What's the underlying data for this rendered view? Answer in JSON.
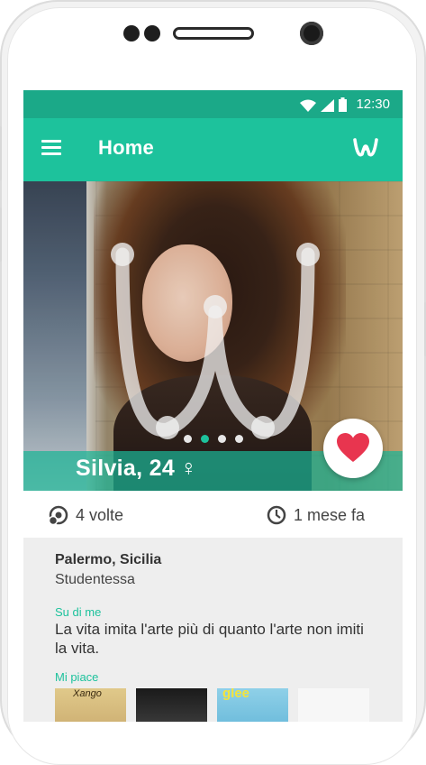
{
  "status_bar": {
    "time": "12:30",
    "icons": [
      "wifi-icon",
      "signal-icon",
      "battery-icon"
    ]
  },
  "app_bar": {
    "title": "Home",
    "menu_icon": "menu-icon",
    "brand_icon": "w-logo-icon"
  },
  "profile": {
    "name_age": "Silvia, 24",
    "gender_symbol": "♀",
    "photo_pages": 4,
    "active_page": 2,
    "like_icon": "heart-icon"
  },
  "stats": {
    "encounters": "4 volte",
    "encounters_icon": "crossed-paths-icon",
    "last_seen": "1 mese fa",
    "last_seen_icon": "clock-icon"
  },
  "info": {
    "location": "Palermo, Sicilia",
    "occupation": "Studentessa",
    "about_label": "Su di me",
    "about_text": "La vita imita l'arte più di quanto l'arte non imiti la vita.",
    "likes_label": "Mi piace",
    "likes": [
      {
        "caption": "Xango"
      },
      {
        "caption": ""
      },
      {
        "caption": "glee"
      },
      {
        "caption": ""
      }
    ]
  },
  "colors": {
    "primary": "#1dc29c",
    "primary_dark": "#1ba988",
    "like": "#e8354f"
  }
}
